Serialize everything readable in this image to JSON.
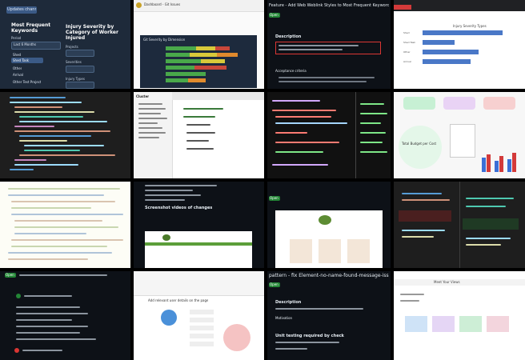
{
  "tiles": {
    "t1": {
      "top_button": "Updates channel",
      "title": "Most Frequent Keywords",
      "period_label": "Period",
      "period_value": "Last 6 Months",
      "right_title": "Injury Severity by Category of Worker Injured",
      "project_label": "Projects",
      "severities_label": "Severities",
      "injury_type_label": "Injury Types",
      "menu": [
        "Shed",
        "Shed Task",
        "Other",
        "Arrival",
        "Other Test Project"
      ]
    },
    "t2": {
      "title": "Dashboard - Git Issues",
      "panel_title": "Git Severity by Dimension"
    },
    "t3": {
      "badge": "Open",
      "heading": "Feature - Add Web Weblink Styles to Most Frequent Keywords component",
      "description_label": "Description",
      "details_label": "Acceptance criteria"
    },
    "t4": {
      "chart_title": "Injury Severity Types",
      "categories": [
        "Shed",
        "Shed Task",
        "Other",
        "Arrival"
      ]
    },
    "t6": {
      "sidebar_title": "Cluster"
    },
    "t8": {
      "card_title": "Total Budget per Cost"
    },
    "t10": {
      "heading": "Screenshot videos of changes"
    },
    "t11": {
      "badge": "Open"
    },
    "t13": {
      "badge": "Open"
    },
    "t14": {
      "header": "Add relevant user details on the page"
    },
    "t15": {
      "title": "pattern - fix Element-no-name-found-message-issues-page",
      "badge": "Open",
      "section1": "Description",
      "section2": "Motivation",
      "section3": "Unit testing required by check"
    },
    "t16": {
      "header": "Meet Your Views"
    }
  }
}
